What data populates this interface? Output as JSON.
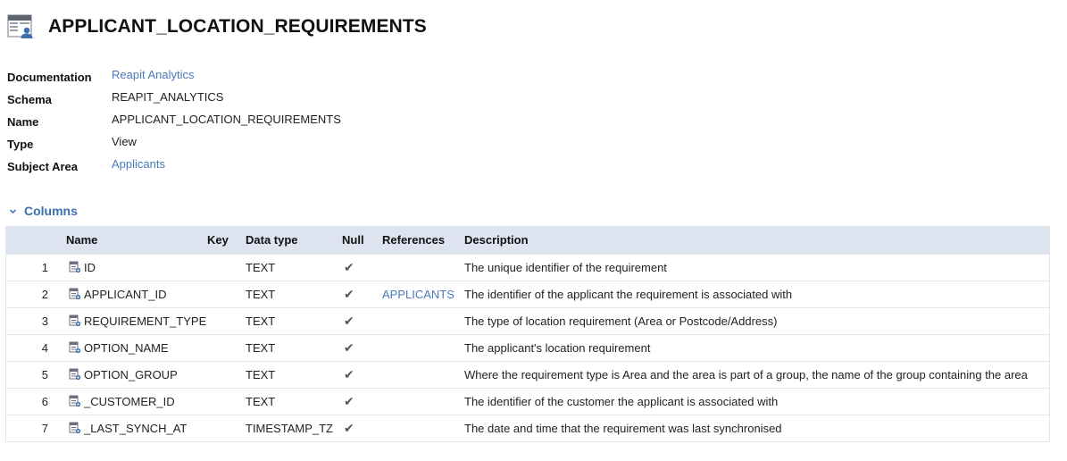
{
  "page": {
    "title": "APPLICANT_LOCATION_REQUIREMENTS",
    "icon": "view-table-icon"
  },
  "properties": [
    {
      "label": "Documentation",
      "value": "Reapit Analytics",
      "is_link": true
    },
    {
      "label": "Schema",
      "value": "REAPIT_ANALYTICS",
      "is_link": false
    },
    {
      "label": "Name",
      "value": "APPLICANT_LOCATION_REQUIREMENTS",
      "is_link": false
    },
    {
      "label": "Type",
      "value": "View",
      "is_link": false
    },
    {
      "label": "Subject Area",
      "value": "Applicants",
      "is_link": true
    }
  ],
  "columns_section": {
    "title": "Columns",
    "expanded": true
  },
  "table": {
    "headers": [
      "",
      "Name",
      "Key",
      "Data type",
      "Null",
      "References",
      "Description"
    ],
    "rows": [
      {
        "num": "1",
        "name": "ID",
        "key": "",
        "type": "TEXT",
        "null": "✔",
        "ref": "",
        "desc": "The unique identifier of the requirement"
      },
      {
        "num": "2",
        "name": "APPLICANT_ID",
        "key": "",
        "type": "TEXT",
        "null": "✔",
        "ref": "APPLICANTS",
        "desc": "The identifier of the applicant the requirement is associated with"
      },
      {
        "num": "3",
        "name": "REQUIREMENT_TYPE",
        "key": "",
        "type": "TEXT",
        "null": "✔",
        "ref": "",
        "desc": "The type of location requirement (Area or Postcode/Address)"
      },
      {
        "num": "4",
        "name": "OPTION_NAME",
        "key": "",
        "type": "TEXT",
        "null": "✔",
        "ref": "",
        "desc": "The applicant's location requirement"
      },
      {
        "num": "5",
        "name": "OPTION_GROUP",
        "key": "",
        "type": "TEXT",
        "null": "✔",
        "ref": "",
        "desc": "Where the requirement type is Area and the area is part of a group, the name of the group containing the area"
      },
      {
        "num": "6",
        "name": "_CUSTOMER_ID",
        "key": "",
        "type": "TEXT",
        "null": "✔",
        "ref": "",
        "desc": "The identifier of the customer the applicant is associated with"
      },
      {
        "num": "7",
        "name": "_LAST_SYNCH_AT",
        "key": "",
        "type": "TIMESTAMP_TZ",
        "null": "✔",
        "ref": "",
        "desc": "The date and time that the requirement was last synchronised"
      }
    ]
  },
  "colors": {
    "link": "#4a7ab8",
    "section_title": "#3d6fb0",
    "header_bg": "#dde3ef"
  }
}
